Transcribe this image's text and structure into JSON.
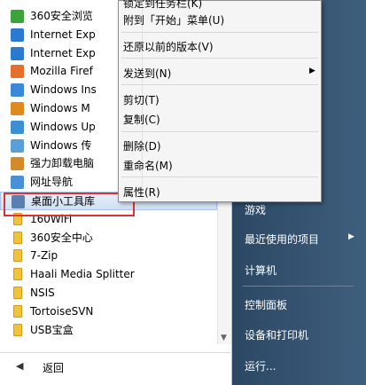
{
  "programs": [
    {
      "label": "360安全浏览",
      "icon": "ie-green-icon",
      "color": "#3aa43a"
    },
    {
      "label": "Internet Exp",
      "icon": "internet-explorer-icon",
      "color": "#2a7ad2"
    },
    {
      "label": "Internet Exp",
      "icon": "internet-explorer-icon",
      "color": "#2a7ad2"
    },
    {
      "label": "Mozilla Firef",
      "icon": "firefox-icon",
      "color": "#e5702b"
    },
    {
      "label": "Windows Ins",
      "icon": "windows-installer-icon",
      "color": "#3b8ad8"
    },
    {
      "label": "Windows M",
      "icon": "media-player-icon",
      "color": "#e08a1e"
    },
    {
      "label": "Windows Up",
      "icon": "windows-update-icon",
      "color": "#3c8fd0"
    },
    {
      "label": "Windows 传",
      "icon": "windows-transfer-icon",
      "color": "#5aa0d8"
    },
    {
      "label": "强力卸载电脑",
      "icon": "uninstaller-icon",
      "color": "#d38b2a"
    },
    {
      "label": "网址导航",
      "icon": "web-navigation-icon",
      "color": "#4a90d8"
    },
    {
      "label": "桌面小工具库",
      "icon": "desktop-gadgets-icon",
      "color": "#5a7fb5",
      "selected": true
    },
    {
      "label": "160WiFi",
      "icon": "folder-icon",
      "folder": true
    },
    {
      "label": "360安全中心",
      "icon": "folder-icon",
      "folder": true
    },
    {
      "label": "7-Zip",
      "icon": "folder-icon",
      "folder": true
    },
    {
      "label": "Haali Media Splitter",
      "icon": "folder-icon",
      "folder": true
    },
    {
      "label": "NSIS",
      "icon": "folder-icon",
      "folder": true
    },
    {
      "label": "TortoiseSVN",
      "icon": "folder-icon",
      "folder": true
    },
    {
      "label": "USB宝盒",
      "icon": "folder-icon",
      "folder": true
    }
  ],
  "back_label": "返回",
  "right_items": [
    {
      "label": "游戏",
      "name": "games"
    },
    {
      "label": "最近使用的项目",
      "name": "recent-items",
      "arrow": "▶"
    },
    {
      "label": "计算机",
      "name": "computer"
    },
    {
      "label": "控制面板",
      "name": "control-panel"
    },
    {
      "label": "设备和打印机",
      "name": "devices-and-printers"
    },
    {
      "label": "运行...",
      "name": "run"
    }
  ],
  "context_menu": {
    "items": [
      {
        "label": "锁定到任务栏(K)",
        "name": "pin-taskbar"
      },
      {
        "label": "附到「开始」菜单(U)",
        "name": "pin-start"
      },
      {
        "label": "还原以前的版本(V)",
        "name": "restore-versions"
      },
      {
        "label": "发送到(N)",
        "name": "send-to",
        "arrow": "▶"
      },
      {
        "label": "剪切(T)",
        "name": "cut"
      },
      {
        "label": "复制(C)",
        "name": "copy"
      },
      {
        "label": "删除(D)",
        "name": "delete"
      },
      {
        "label": "重命名(M)",
        "name": "rename"
      },
      {
        "label": "属性(R)",
        "name": "properties"
      }
    ]
  },
  "colors": {
    "highlight": "#e03030",
    "right_pane": "#2b4763"
  }
}
